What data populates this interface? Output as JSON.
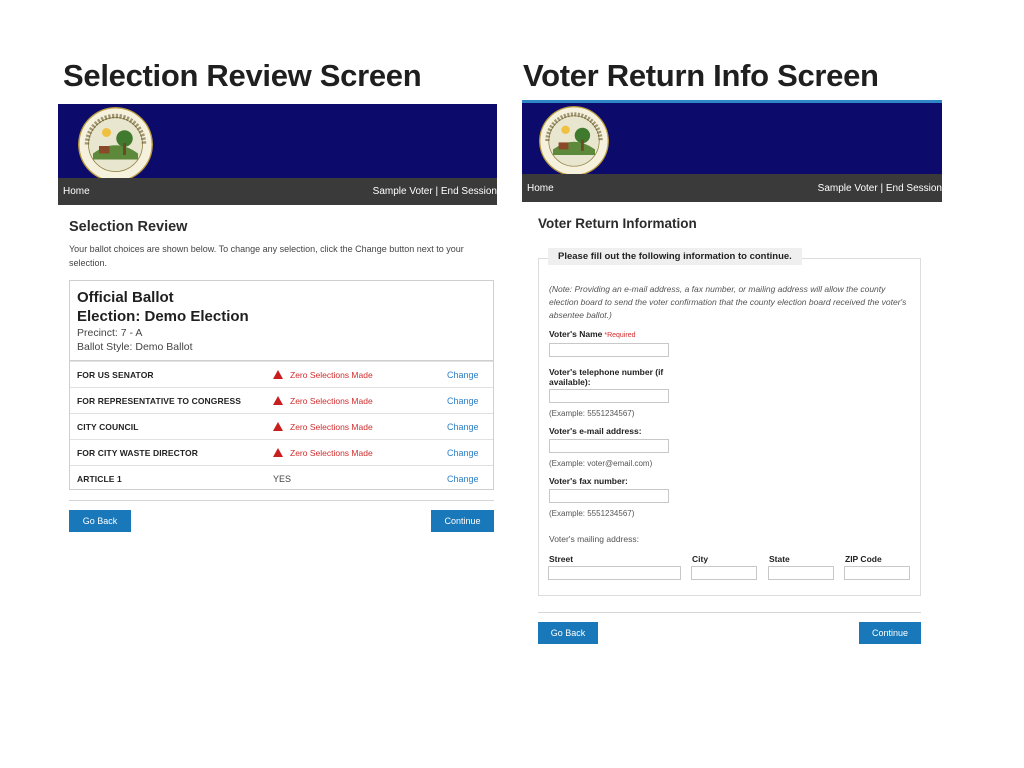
{
  "slide": {
    "left_title": "Selection Review Screen",
    "right_title": "Voter Return Info Screen"
  },
  "colors": {
    "banner": "#0c0a6a",
    "navbar": "#3a3a3a",
    "button": "#1878b9",
    "link": "#2d7fc5",
    "warning": "#d12d2d"
  },
  "left_panel": {
    "nav": {
      "home": "Home",
      "user_menu": "Sample Voter | End Session"
    },
    "heading": "Selection Review",
    "instructions": "Your ballot choices are shown below. To change any selection, click the Change button next to your selection.",
    "ballot": {
      "title": "Official Ballot",
      "election": "Election: Demo Election",
      "precinct": "Precinct: 7 - A",
      "style": "Ballot Style: Demo Ballot"
    },
    "contests": [
      {
        "name": "FOR US SENATOR",
        "status": "Zero Selections Made",
        "warning": true,
        "action": "Change"
      },
      {
        "name": "FOR REPRESENTATIVE TO CONGRESS",
        "status": "Zero Selections Made",
        "warning": true,
        "action": "Change"
      },
      {
        "name": "CITY COUNCIL",
        "status": "Zero Selections Made",
        "warning": true,
        "action": "Change"
      },
      {
        "name": "FOR CITY WASTE DIRECTOR",
        "status": "Zero Selections Made",
        "warning": true,
        "action": "Change"
      },
      {
        "name": "ARTICLE 1",
        "status": "YES",
        "warning": false,
        "action": "Change"
      }
    ],
    "buttons": {
      "go_back": "Go Back",
      "continue": "Continue"
    }
  },
  "right_panel": {
    "nav": {
      "home": "Home",
      "user_menu": "Sample Voter | End Session"
    },
    "heading": "Voter Return Information",
    "legend": "Please fill out the following information to continue.",
    "note": "(Note: Providing an e-mail address, a fax number, or mailing address will allow the county election board to send the voter confirmation that the county election board received the voter's absentee ballot.)",
    "fields": {
      "name_label": "Voter's Name",
      "required": "*Required",
      "phone_label": "Voter's telephone number (if available):",
      "phone_example": "(Example: 5551234567)",
      "email_label": "Voter's e-mail address:",
      "email_example": "(Example: voter@email.com)",
      "fax_label": "Voter's fax number:",
      "fax_example": "(Example: 5551234567)",
      "mailing_label": "Voter's mailing address:",
      "street": "Street",
      "city": "City",
      "state": "State",
      "zip": "ZIP Code"
    },
    "buttons": {
      "go_back": "Go Back",
      "continue": "Continue"
    }
  }
}
